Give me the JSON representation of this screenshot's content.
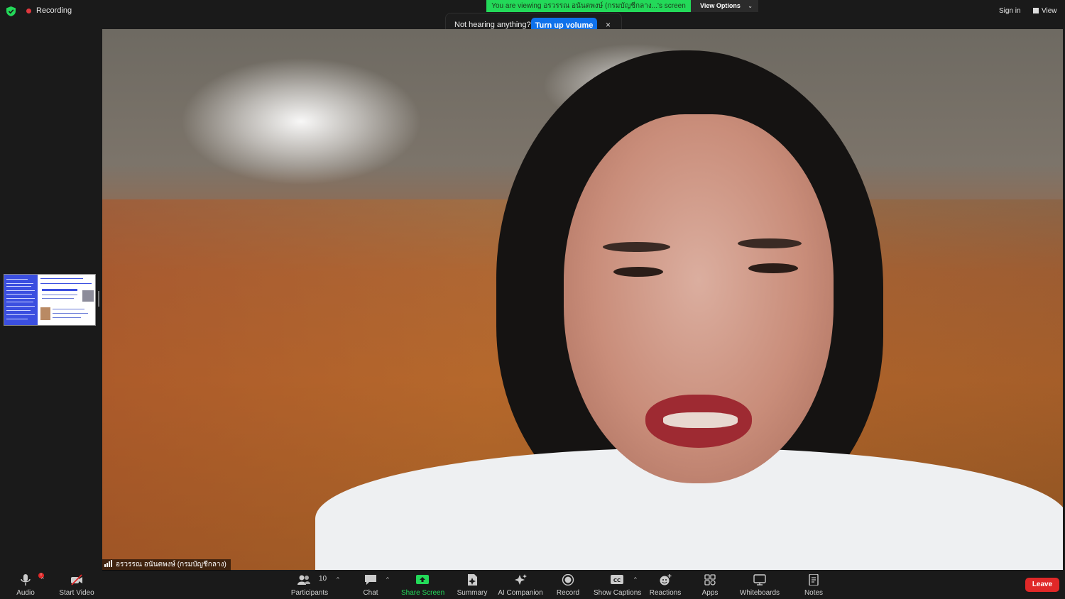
{
  "topbar": {
    "recording_label": "Recording",
    "viewing_banner": "You are viewing อรวรรณ อนันตพงษ์ (กรมบัญชีกลาง...'s screen",
    "view_options_label": "View Options",
    "sign_in_label": "Sign in",
    "view_label": "View"
  },
  "toast": {
    "message": "Not hearing anything?",
    "button_label": "Turn up volume",
    "close_glyph": "×"
  },
  "video": {
    "participant_name": "อรวรรณ อนันตพงษ์ (กรมบัญชีกลาง)"
  },
  "toolbar": {
    "audio_label": "Audio",
    "audio_badge": "!",
    "start_video_label": "Start Video",
    "participants_label": "Participants",
    "participants_count": "10",
    "chat_label": "Chat",
    "share_screen_label": "Share Screen",
    "summary_label": "Summary",
    "ai_companion_label": "AI Companion",
    "record_label": "Record",
    "show_captions_label": "Show Captions",
    "reactions_label": "Reactions",
    "apps_label": "Apps",
    "whiteboards_label": "Whiteboards",
    "notes_label": "Notes",
    "leave_label": "Leave"
  },
  "colors": {
    "banner_green": "#23d959",
    "toast_button_blue": "#0e71eb",
    "leave_red": "#e02828",
    "recording_red": "#e0383e"
  },
  "icons": [
    "shield-icon",
    "recording-dot-icon",
    "chevron-down-icon",
    "view-icon",
    "close-icon",
    "signal-bars-icon",
    "microphone-icon",
    "video-off-icon",
    "participants-icon",
    "chat-icon",
    "share-screen-icon",
    "summary-icon",
    "ai-companion-icon",
    "record-icon",
    "captions-icon",
    "reactions-icon",
    "apps-icon",
    "whiteboards-icon",
    "notes-icon"
  ]
}
